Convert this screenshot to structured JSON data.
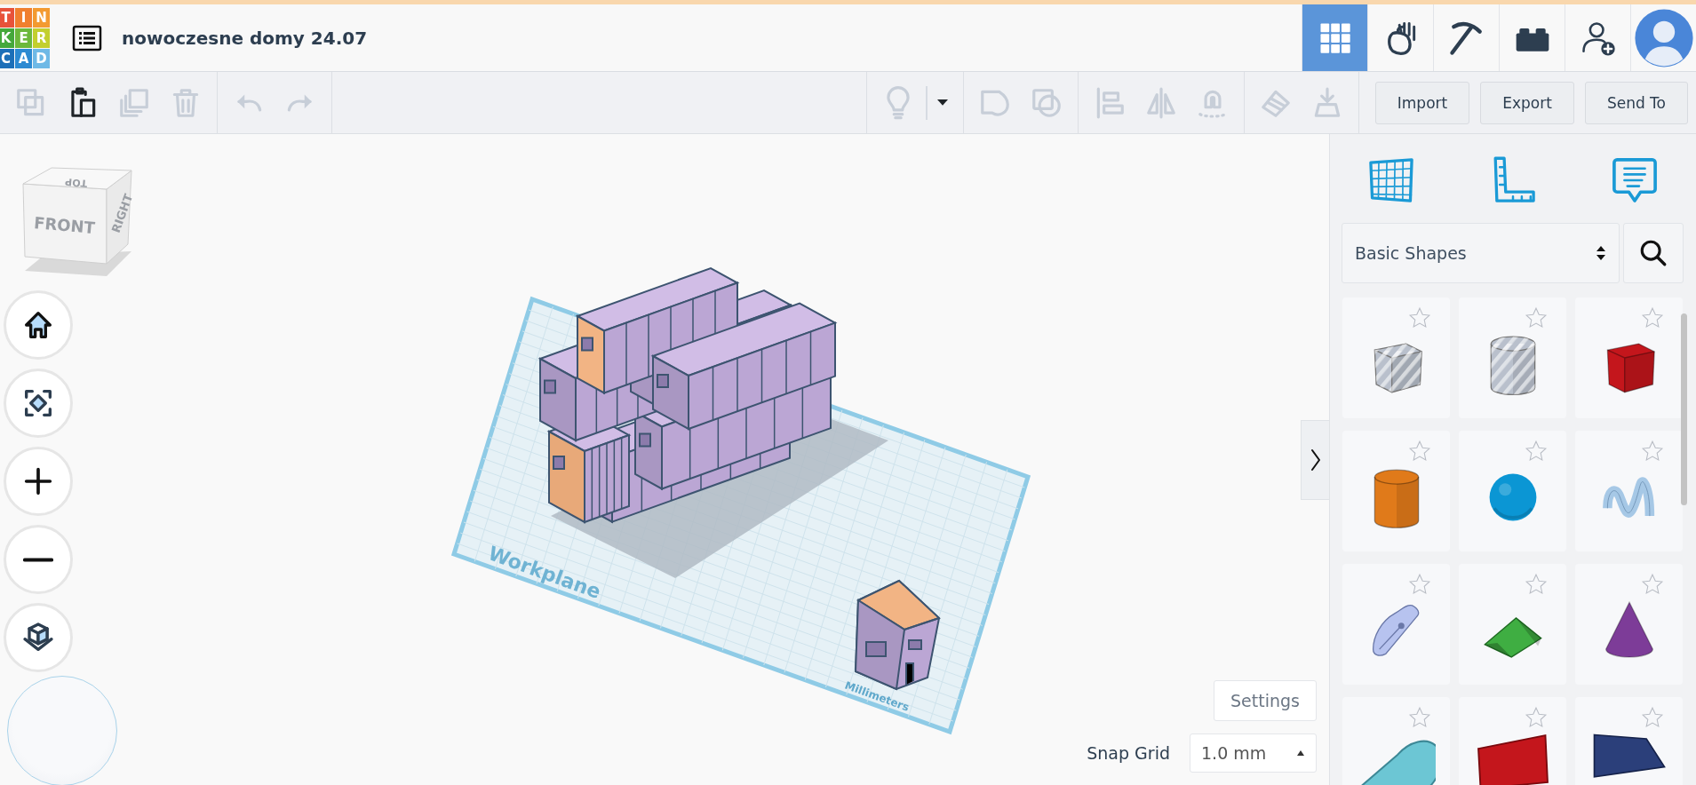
{
  "logo": {
    "letters": [
      {
        "char": "T",
        "color": "#e8523a"
      },
      {
        "char": "I",
        "color": "#f07f2e"
      },
      {
        "char": "N",
        "color": "#f39a30"
      },
      {
        "char": "K",
        "color": "#45a83b"
      },
      {
        "char": "E",
        "color": "#6cb83c"
      },
      {
        "char": "R",
        "color": "#c3cf2e"
      },
      {
        "char": "C",
        "color": "#1c6fb8"
      },
      {
        "char": "A",
        "color": "#2c8ad2"
      },
      {
        "char": "D",
        "color": "#6fb9e6"
      }
    ]
  },
  "title": "nowoczesne domy 24.07",
  "header_buttons": [
    {
      "kind": "grid",
      "selected": true
    },
    {
      "kind": "blocks",
      "selected": false
    },
    {
      "kind": "pickaxe",
      "selected": false
    },
    {
      "kind": "bricks",
      "selected": false
    },
    {
      "kind": "invite",
      "selected": false
    },
    {
      "kind": "avatar",
      "selected": false
    }
  ],
  "toolbar": {
    "groups": [
      {
        "tools": [
          {
            "kind": "copy",
            "disabled": true
          },
          {
            "kind": "paste",
            "disabled": false
          },
          {
            "kind": "duplicate",
            "disabled": true
          },
          {
            "kind": "delete",
            "disabled": true
          }
        ]
      },
      {
        "tools": [
          {
            "kind": "undo",
            "disabled": true
          },
          {
            "kind": "redo",
            "disabled": true
          }
        ]
      },
      {
        "tools": [
          {
            "kind": "light",
            "disabled": true
          },
          {
            "kind": "caret",
            "disabled": false
          }
        ]
      },
      {
        "tools": [
          {
            "kind": "group",
            "disabled": true
          },
          {
            "kind": "ungroup",
            "disabled": true
          }
        ]
      },
      {
        "tools": [
          {
            "kind": "align",
            "disabled": true
          },
          {
            "kind": "mirror",
            "disabled": true
          },
          {
            "kind": "magnet",
            "disabled": true
          }
        ]
      },
      {
        "tools": [
          {
            "kind": "workplane",
            "disabled": true
          },
          {
            "kind": "drop",
            "disabled": true
          }
        ]
      }
    ],
    "actions": [
      "Import",
      "Export",
      "Send To"
    ]
  },
  "view_cube": {
    "top": "TOP",
    "front": "FRONT",
    "right": "RIGHT"
  },
  "nav_buttons": [
    {
      "kind": "home"
    },
    {
      "kind": "fit"
    },
    {
      "kind": "zoom_in"
    },
    {
      "kind": "zoom_out"
    },
    {
      "kind": "ortho"
    }
  ],
  "workplane": {
    "label": "Workplane",
    "units": "Millimeters"
  },
  "settings_button": "Settings",
  "snap_grid": {
    "label": "Snap Grid",
    "value": "1.0 mm"
  },
  "panel": {
    "tools": [
      {
        "kind": "workplane"
      },
      {
        "kind": "ruler"
      },
      {
        "kind": "notes"
      }
    ],
    "category": "Basic Shapes",
    "shapes": [
      {
        "kind": "box",
        "hole": true,
        "favorite": false,
        "color": "#b9c0cc"
      },
      {
        "kind": "cylinder",
        "hole": true,
        "favorite": false,
        "color": "#b9c0cc"
      },
      {
        "kind": "box",
        "hole": false,
        "favorite": false,
        "color": "#c4161c"
      },
      {
        "kind": "cylinder",
        "hole": false,
        "favorite": false,
        "color": "#e07a1a"
      },
      {
        "kind": "sphere",
        "hole": false,
        "favorite": false,
        "color": "#0b96d4"
      },
      {
        "kind": "scribble",
        "hole": false,
        "favorite": false,
        "color": "#a6c8e6"
      },
      {
        "kind": "pen",
        "hole": false,
        "favorite": false,
        "color": "#b7c3ef"
      },
      {
        "kind": "roof",
        "hole": false,
        "favorite": false,
        "color": "#3fae42"
      },
      {
        "kind": "cone",
        "hole": false,
        "favorite": false,
        "color": "#7d3c98"
      },
      {
        "kind": "tube",
        "hole": false,
        "favorite": false,
        "color": "#6cc6d4"
      },
      {
        "kind": "text",
        "hole": false,
        "favorite": false,
        "color": "#c4161c"
      },
      {
        "kind": "wedge",
        "hole": false,
        "favorite": false,
        "color": "#2b3f7a"
      }
    ]
  }
}
